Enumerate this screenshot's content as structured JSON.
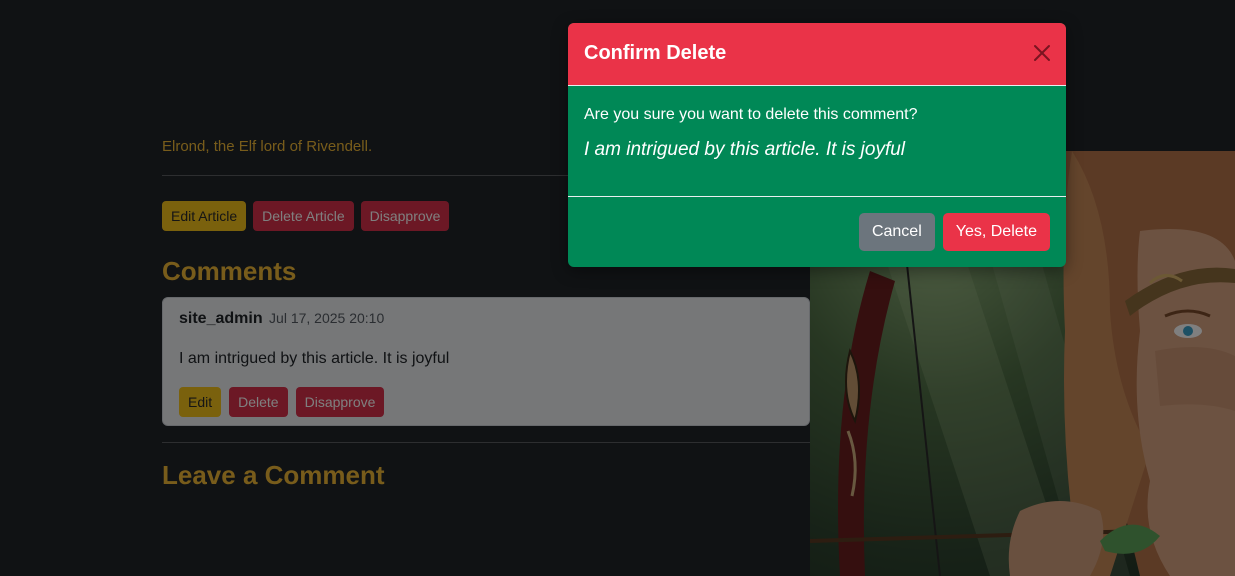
{
  "article": {
    "caption": "Elrond, the Elf lord of Rivendell.",
    "buttons": {
      "edit": "Edit Article",
      "delete": "Delete Article",
      "disapprove": "Disapprove"
    }
  },
  "comments": {
    "heading": "Comments",
    "items": [
      {
        "author": "site_admin",
        "date": "Jul 17, 2025 20:10",
        "text": "I am intrigued by this article. It is joyful",
        "buttons": {
          "edit": "Edit",
          "delete": "Delete",
          "disapprove": "Disapprove"
        }
      }
    ]
  },
  "leave_comment": {
    "heading": "Leave a Comment"
  },
  "modal": {
    "title": "Confirm Delete",
    "question": "Are you sure you want to delete this comment?",
    "quote": "I am intrigued by this article. It is joyful",
    "cancel_label": "Cancel",
    "confirm_label": "Yes, Delete"
  },
  "colors": {
    "page_bg": "#212529",
    "accent_gold": "#f0b936",
    "warning": "#f5c21a",
    "danger": "#ea3348",
    "modal_body": "#008856",
    "secondary": "#6c757d"
  },
  "icons": {
    "close": "close-icon"
  }
}
